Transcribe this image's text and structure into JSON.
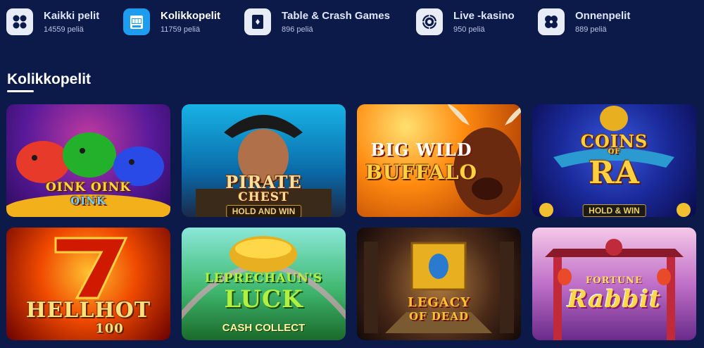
{
  "categories": [
    {
      "name": "Kaikki pelit",
      "count": "14559 peliä",
      "icon": "grid-icon",
      "active": false
    },
    {
      "name": "Kolikkopelit",
      "count": "11759 peliä",
      "icon": "slot-machine-icon",
      "active": true
    },
    {
      "name": "Table & Crash Games",
      "count": "896 peliä",
      "icon": "playing-card-icon",
      "active": false
    },
    {
      "name": "Live -kasino",
      "count": "950 peliä",
      "icon": "roulette-wheel-icon",
      "active": false
    },
    {
      "name": "Onnenpelit",
      "count": "889 peliä",
      "icon": "clover-icon",
      "active": false
    }
  ],
  "section": {
    "title": "Kolikkopelit"
  },
  "games": [
    {
      "title_a": "OINK OINK",
      "title_b": "OINK",
      "colors": [
        "#4a1a8a",
        "#ff8a1a"
      ]
    },
    {
      "title_a": "PIRATE",
      "title_b": "CHEST",
      "subtitle": "HOLD AND WIN",
      "colors": [
        "#0a9bd0",
        "#1a3a6a"
      ]
    },
    {
      "title_a": "BIG WILD",
      "title_b": "BUFFALO",
      "colors": [
        "#ff9a10",
        "#7a1a00"
      ]
    },
    {
      "title_a": "COINS",
      "title_small": "OF",
      "title_b": "RA",
      "subtitle": "HOLD & WIN",
      "colors": [
        "#1a2a8a",
        "#0a0a3a"
      ]
    },
    {
      "title_a": "HELLHOT",
      "title_b": "100",
      "colors": [
        "#ff3a00",
        "#6a0000"
      ]
    },
    {
      "title_a": "LEPRECHAUN'S",
      "title_b": "LUCK",
      "subtitle": "CASH COLLECT",
      "colors": [
        "#7ae0d0",
        "#2a8a3a"
      ]
    },
    {
      "title_a": "LEGACY",
      "title_b": "OF DEAD",
      "colors": [
        "#6a4a2a",
        "#1a0a0a"
      ]
    },
    {
      "title_a": "FORTUNE",
      "title_b": "Rabbit",
      "colors": [
        "#f0b0d8",
        "#8a2a8a"
      ]
    }
  ]
}
